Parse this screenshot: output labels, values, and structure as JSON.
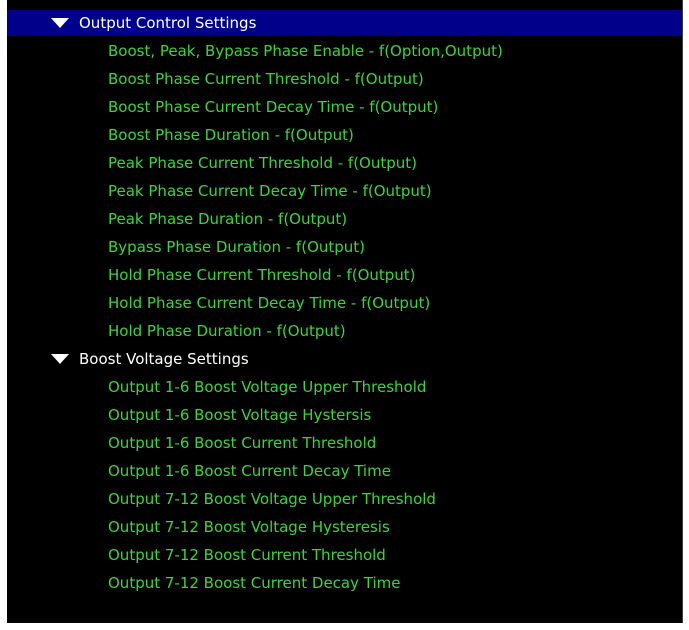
{
  "colors": {
    "background": "#000000",
    "selection": "#00008a",
    "group_text": "#ffffff",
    "item_text": "#3fd23f"
  },
  "tree": {
    "groups": [
      {
        "label": "Output Control Settings",
        "expanded": true,
        "selected": true,
        "expander_icon": "triangle-down-icon",
        "items": [
          "Boost, Peak, Bypass Phase Enable - f(Option,Output)",
          "Boost Phase Current Threshold - f(Output)",
          "Boost Phase Current Decay Time - f(Output)",
          "Boost Phase Duration - f(Output)",
          "Peak Phase Current Threshold - f(Output)",
          "Peak Phase Current Decay Time - f(Output)",
          "Peak Phase Duration - f(Output)",
          "Bypass Phase Duration - f(Output)",
          "Hold Phase Current Threshold - f(Output)",
          "Hold Phase Current Decay Time - f(Output)",
          "Hold Phase Duration - f(Output)"
        ]
      },
      {
        "label": "Boost Voltage Settings",
        "expanded": true,
        "selected": false,
        "expander_icon": "triangle-down-icon",
        "items": [
          "Output 1-6 Boost Voltage Upper Threshold",
          "Output 1-6 Boost Voltage Hystersis",
          "Output 1-6 Boost Current Threshold",
          "Output 1-6 Boost Current Decay Time",
          "Output 7-12 Boost Voltage Upper Threshold",
          "Output 7-12 Boost Voltage Hysteresis",
          "Output 7-12 Boost Current Threshold",
          "Output 7-12 Boost Current Decay Time"
        ]
      }
    ]
  }
}
